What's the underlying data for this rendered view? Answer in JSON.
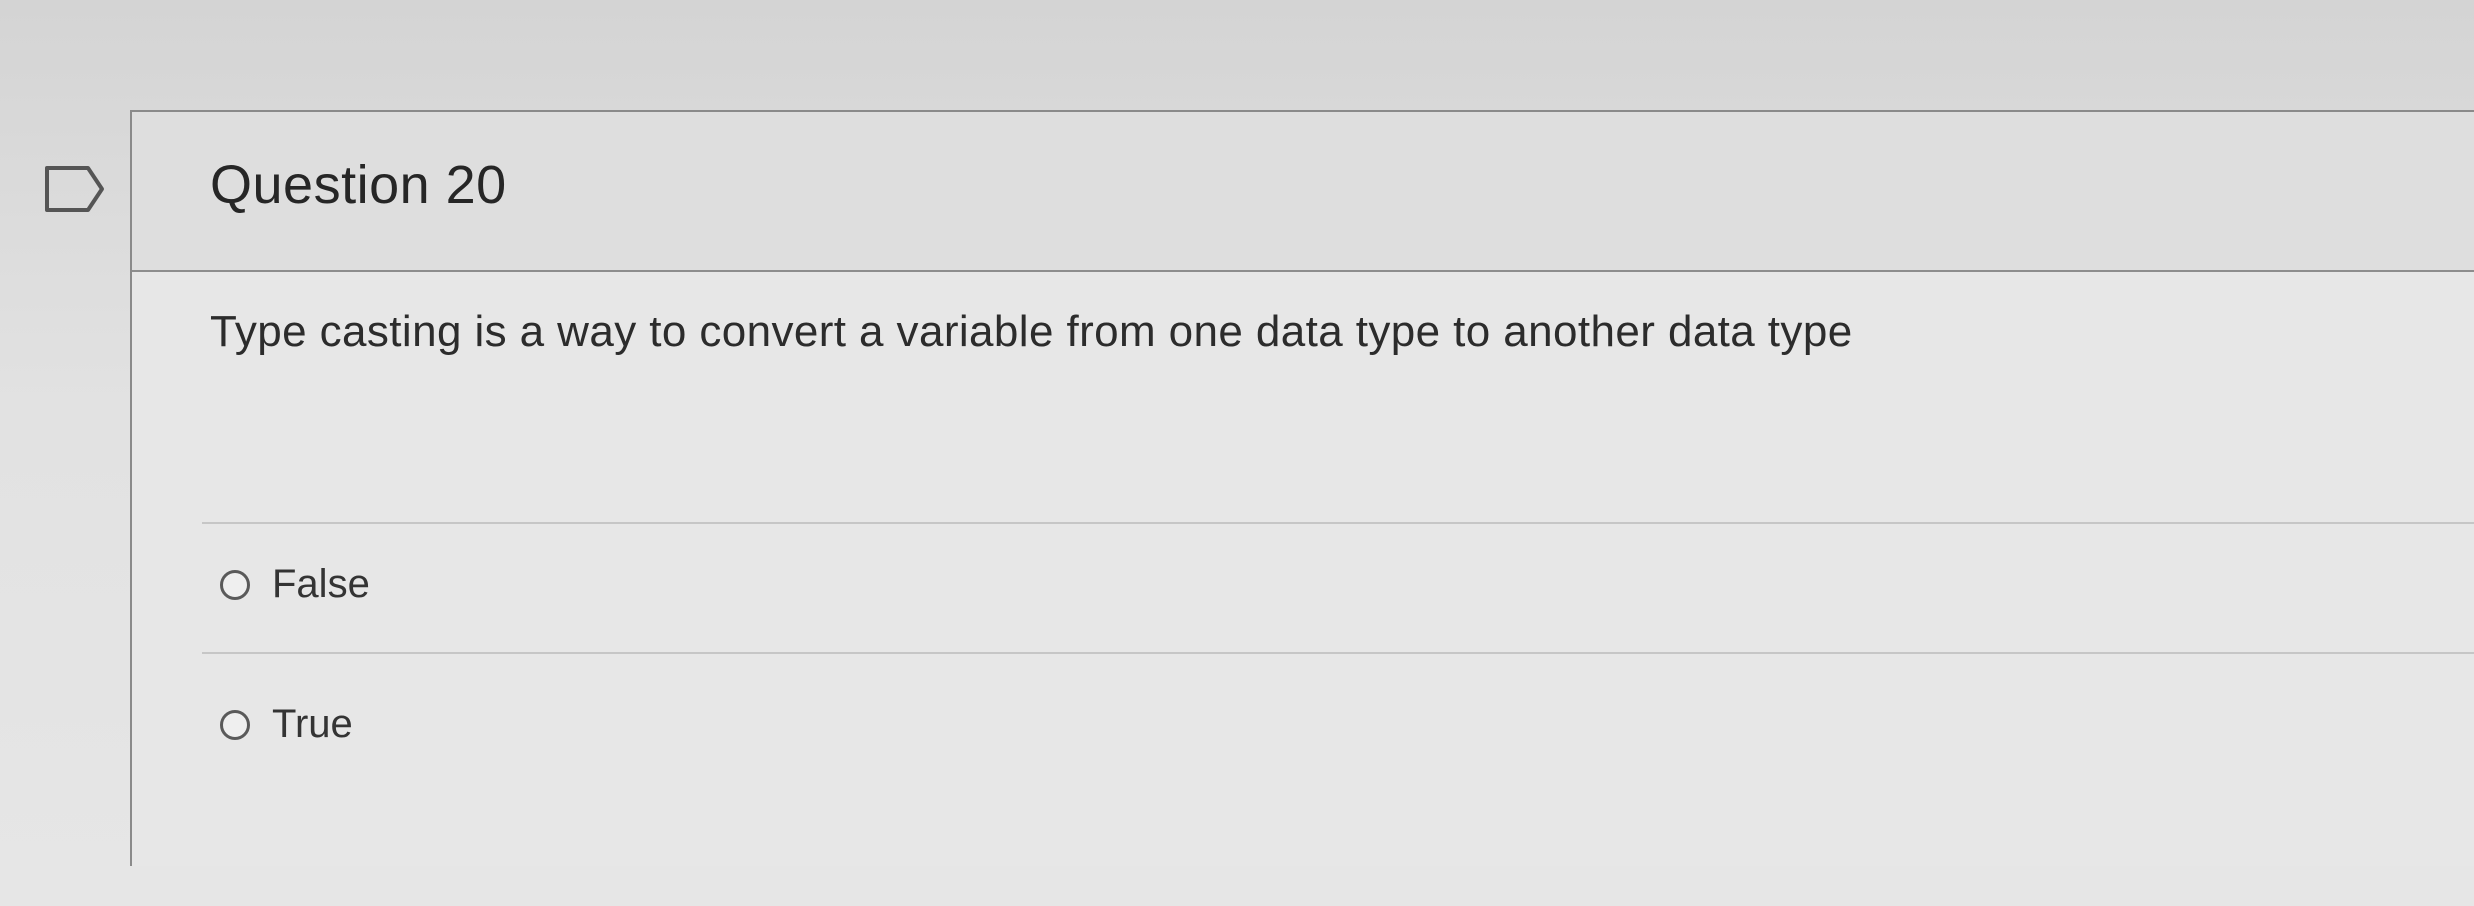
{
  "question": {
    "flag_icon": "bookmark-flag-icon",
    "title": "Question 20",
    "text": "Type casting is a way to convert a variable from one data type to another data type"
  },
  "answers": [
    {
      "label": "False",
      "selected": false
    },
    {
      "label": "True",
      "selected": false
    }
  ]
}
